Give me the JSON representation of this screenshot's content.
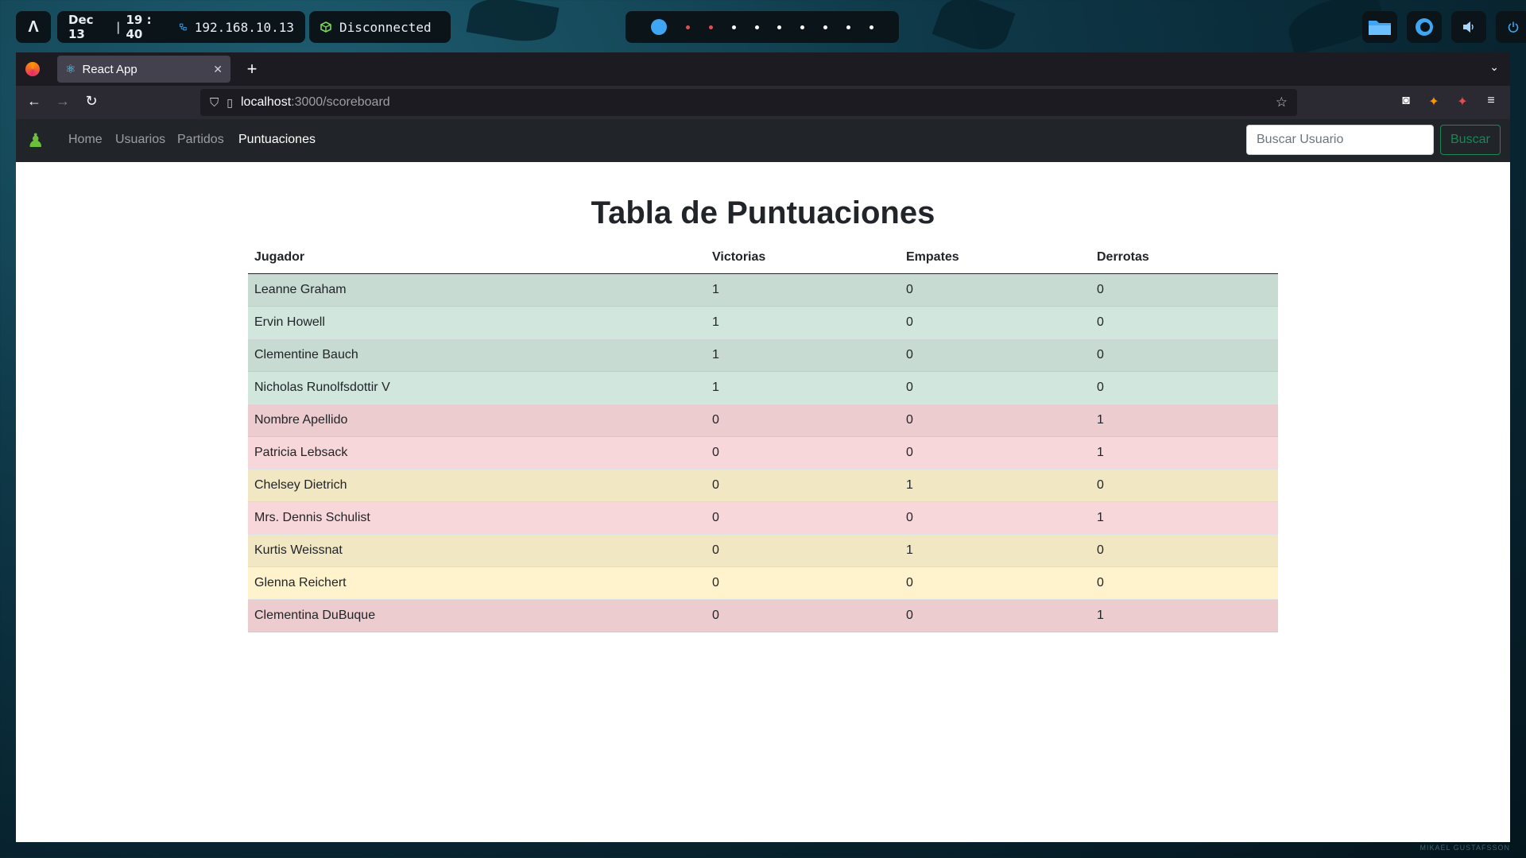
{
  "desktop": {
    "launcher_glyph": "Λ",
    "date": "Dec 13",
    "time": "19 : 40",
    "ip": "192.168.10.13",
    "vpn_status": "Disconnected",
    "workspaces": [
      "active",
      "red",
      "red",
      "dot",
      "dot",
      "dot",
      "dot",
      "dot",
      "dot",
      "dot"
    ],
    "tray_icons": [
      "folder-icon",
      "firefox-icon",
      "volume-icon",
      "power-icon"
    ],
    "wallpaper_signature": "MIKAEL GUSTAFSSON"
  },
  "browser": {
    "tab_title": "React App",
    "new_tab_label": "+",
    "url_host": "localhost",
    "url_rest": ":3000/scoreboard"
  },
  "app_nav": {
    "links": [
      {
        "label": "Home",
        "active": false
      },
      {
        "label": "Usuarios",
        "active": false
      },
      {
        "label": "Partidos",
        "active": false
      },
      {
        "label": "Puntuaciones",
        "active": true
      }
    ],
    "search_placeholder": "Buscar Usuario",
    "search_button": "Buscar"
  },
  "page": {
    "title": "Tabla de Puntuaciones",
    "columns": [
      "Jugador",
      "Victorias",
      "Empates",
      "Derrotas"
    ],
    "rows": [
      {
        "player": "Leanne Graham",
        "wins": "1",
        "draws": "0",
        "losses": "0",
        "status": "win"
      },
      {
        "player": "Ervin Howell",
        "wins": "1",
        "draws": "0",
        "losses": "0",
        "status": "win"
      },
      {
        "player": "Clementine Bauch",
        "wins": "1",
        "draws": "0",
        "losses": "0",
        "status": "win"
      },
      {
        "player": "Nicholas Runolfsdottir V",
        "wins": "1",
        "draws": "0",
        "losses": "0",
        "status": "win"
      },
      {
        "player": "Nombre Apellido",
        "wins": "0",
        "draws": "0",
        "losses": "1",
        "status": "loss"
      },
      {
        "player": "Patricia Lebsack",
        "wins": "0",
        "draws": "0",
        "losses": "1",
        "status": "loss"
      },
      {
        "player": "Chelsey Dietrich",
        "wins": "0",
        "draws": "1",
        "losses": "0",
        "status": "draw"
      },
      {
        "player": "Mrs. Dennis Schulist",
        "wins": "0",
        "draws": "0",
        "losses": "1",
        "status": "loss"
      },
      {
        "player": "Kurtis Weissnat",
        "wins": "0",
        "draws": "1",
        "losses": "0",
        "status": "draw"
      },
      {
        "player": "Glenna Reichert",
        "wins": "0",
        "draws": "0",
        "losses": "0",
        "status": "draw"
      },
      {
        "player": "Clementina DuBuque",
        "wins": "0",
        "draws": "0",
        "losses": "1",
        "status": "loss"
      }
    ]
  },
  "colors": {
    "win_row": "#d1e7dd",
    "loss_row": "#f8d7da",
    "draw_row": "#fff3cd",
    "navbar_bg": "#212529",
    "success": "#198754"
  }
}
